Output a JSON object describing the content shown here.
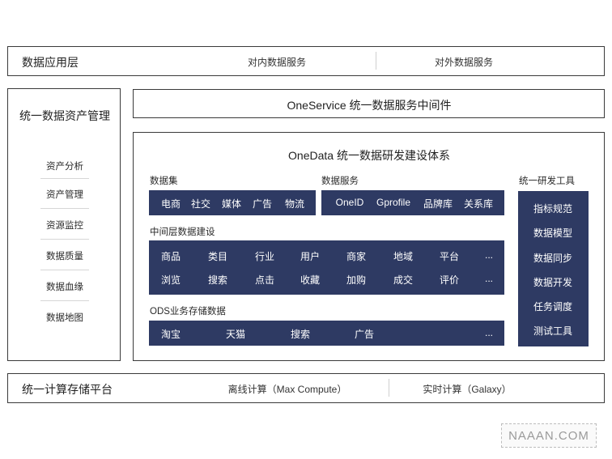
{
  "application_layer": {
    "title": "数据应用层",
    "items": [
      "对内数据服务",
      "对外数据服务"
    ]
  },
  "asset_management": {
    "title": "统一数据资产管理",
    "items": [
      "资产分析",
      "资产管理",
      "资源监控",
      "数据质量",
      "数据血缘",
      "数据地图"
    ]
  },
  "oneservice": {
    "title": "OneService 统一数据服务中间件"
  },
  "onedata": {
    "title": "OneData 统一数据研发建设体系",
    "dataset": {
      "title": "数据集",
      "items": [
        "电商",
        "社交",
        "媒体",
        "广告",
        "物流"
      ]
    },
    "data_service": {
      "title": "数据服务",
      "items": [
        "OneID",
        "Gprofile",
        "品牌库",
        "关系库"
      ]
    },
    "middle_layer": {
      "title": "中间层数据建设",
      "row1": [
        "商品",
        "类目",
        "行业",
        "用户",
        "商家",
        "地域",
        "平台",
        "..."
      ],
      "row2": [
        "浏览",
        "搜索",
        "点击",
        "收藏",
        "加购",
        "成交",
        "评价",
        "..."
      ]
    },
    "ods": {
      "title": "ODS业务存储数据",
      "items": [
        "淘宝",
        "天猫",
        "搜索",
        "广告",
        "..."
      ]
    },
    "dev_tools": {
      "title": "统一研发工具",
      "items": [
        "指标规范",
        "数据模型",
        "数据同步",
        "数据开发",
        "任务调度",
        "测试工具"
      ]
    }
  },
  "compute_platform": {
    "title": "统一计算存储平台",
    "items": [
      "离线计算（Max Compute）",
      "实时计算（Galaxy）"
    ]
  },
  "watermark": {
    "text": "NAAAN.COM"
  },
  "colors": {
    "navy": "#2e3a63",
    "border": "#3a3a3a"
  }
}
